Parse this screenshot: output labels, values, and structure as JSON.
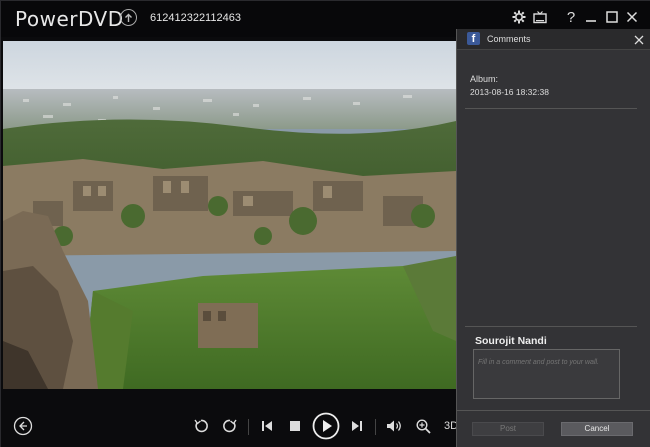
{
  "app": {
    "title": "PowerDVD",
    "file_name": "612412322112463"
  },
  "titlebar_icons": [
    "upload-icon",
    "gear-icon",
    "tv-mode-icon",
    "help-icon",
    "minimize-icon",
    "maximize-icon",
    "close-icon"
  ],
  "titlebar_help_glyph": "?",
  "controls": {
    "icons": [
      "back-icon",
      "rotate-left-icon",
      "rotate-right-icon",
      "previous-icon",
      "stop-icon",
      "play-icon",
      "next-icon",
      "volume-icon",
      "zoom-icon"
    ],
    "mode_label": "3D"
  },
  "comments_panel": {
    "title": "Comments",
    "album_label": "Album:",
    "album_date": "2013-08-16 18:32:38",
    "user_name": "Sourojit Nandi",
    "comment_placeholder": "Fill in a comment and post to your wall.",
    "post_button": "Post",
    "cancel_button": "Cancel",
    "fb_glyph": "f"
  },
  "colors": {
    "background": "#0b0b0d",
    "panel": "#333336",
    "facebook": "#3b5998"
  }
}
